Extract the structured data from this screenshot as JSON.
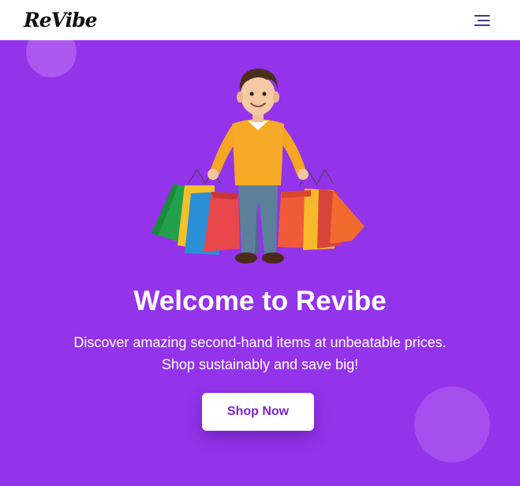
{
  "navbar": {
    "logo": "ReVibe",
    "menu_icon": "hamburger-menu-icon"
  },
  "hero": {
    "title": "Welcome to Revibe",
    "line1": "Discover amazing second-hand items at unbeatable prices.",
    "line2": "Shop sustainably and save big!",
    "button_label": "Shop Now",
    "illustration": "shopper-with-bags-illustration"
  },
  "colors": {
    "background": "#9333ea",
    "navbar": "#ffffff",
    "button_text": "#7e22ce",
    "blob": "#b366f0"
  }
}
